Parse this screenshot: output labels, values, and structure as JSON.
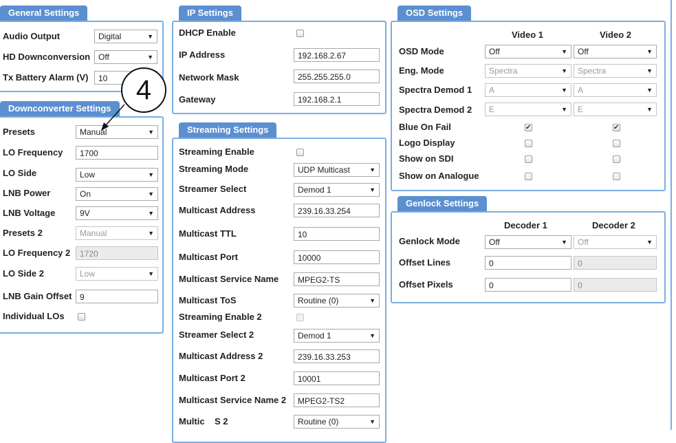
{
  "general": {
    "title": "General Settings",
    "audio_output_label": "Audio Output",
    "audio_output_value": "Digital",
    "hd_down_label": "HD Downconversion",
    "hd_down_value": "Off",
    "tx_batt_label": "Tx Battery Alarm (V)",
    "tx_batt_value": "10"
  },
  "downconverter": {
    "title": "Downconverter Settings",
    "presets_label": "Presets",
    "presets_value": "Manual",
    "lo_freq_label": "LO Frequency",
    "lo_freq_value": "1700",
    "lo_side_label": "LO Side",
    "lo_side_value": "Low",
    "lnb_power_label": "LNB Power",
    "lnb_power_value": "On",
    "lnb_voltage_label": "LNB Voltage",
    "lnb_voltage_value": "9V",
    "presets2_label": "Presets 2",
    "presets2_value": "Manual",
    "lo_freq2_label": "LO Frequency 2",
    "lo_freq2_value": "1720",
    "lo_side2_label": "LO Side 2",
    "lo_side2_value": "Low",
    "lnb_gain_label": "LNB Gain Offset",
    "lnb_gain_value": "9",
    "individual_los_label": "Individual LOs",
    "individual_los_checked": false
  },
  "ip": {
    "title": "IP Settings",
    "dhcp_label": "DHCP Enable",
    "dhcp_checked": false,
    "ip_label": "IP Address",
    "ip_value": "192.168.2.67",
    "mask_label": "Network Mask",
    "mask_value": "255.255.255.0",
    "gateway_label": "Gateway",
    "gateway_value": "192.168.2.1"
  },
  "streaming": {
    "title": "Streaming Settings",
    "enable_label": "Streaming Enable",
    "enable_checked": false,
    "mode_label": "Streaming Mode",
    "mode_value": "UDP Multicast",
    "select_label": "Streamer Select",
    "select_value": "Demod 1",
    "mc_addr_label": "Multicast Address",
    "mc_addr_value": "239.16.33.254",
    "mc_ttl_label": "Multicast TTL",
    "mc_ttl_value": "10",
    "mc_port_label": "Multicast Port",
    "mc_port_value": "10000",
    "mc_svc_label": "Multicast Service Name",
    "mc_svc_value": "MPEG2-TS",
    "mc_tos_label": "Multicast ToS",
    "mc_tos_value": "Routine (0)",
    "enable2_label": "Streaming Enable 2",
    "enable2_checked": false,
    "select2_label": "Streamer Select 2",
    "select2_value": "Demod 1",
    "mc_addr2_label": "Multicast Address 2",
    "mc_addr2_value": "239.16.33.253",
    "mc_port2_label": "Multicast Port 2",
    "mc_port2_value": "10001",
    "mc_svc2_label": "Multicast Service Name 2",
    "mc_svc2_value": "MPEG2-TS2",
    "mc_tos2_label": "Multic    S 2",
    "mc_tos2_value": "Routine (0)"
  },
  "osd": {
    "title": "OSD Settings",
    "col1": "Video 1",
    "col2": "Video 2",
    "mode_label": "OSD Mode",
    "mode_v1": "Off",
    "mode_v2": "Off",
    "eng_label": "Eng. Mode",
    "eng_v1": "Spectra",
    "eng_v2": "Spectra",
    "sd1_label": "Spectra Demod 1",
    "sd1_v1": "A",
    "sd1_v2": "A",
    "sd2_label": "Spectra Demod 2",
    "sd2_v1": "E",
    "sd2_v2": "E",
    "blue_label": "Blue On Fail",
    "logo_label": "Logo Display",
    "sdi_label": "Show on SDI",
    "analogue_label": "Show on Analogue"
  },
  "genlock": {
    "title": "Genlock Settings",
    "col1": "Decoder 1",
    "col2": "Decoder 2",
    "mode_label": "Genlock Mode",
    "mode_d1": "Off",
    "mode_d2": "Off",
    "lines_label": "Offset Lines",
    "lines_d1": "0",
    "lines_d2": "0",
    "pixels_label": "Offset Pixels",
    "pixels_d1": "0",
    "pixels_d2": "0"
  },
  "callout_number": "4",
  "icons": {
    "dropdown": "chevron-down-icon",
    "checkmark": "checkmark-icon"
  },
  "colors": {
    "header_bg": "#5b8fd0",
    "panel_border": "#7aaee4"
  }
}
